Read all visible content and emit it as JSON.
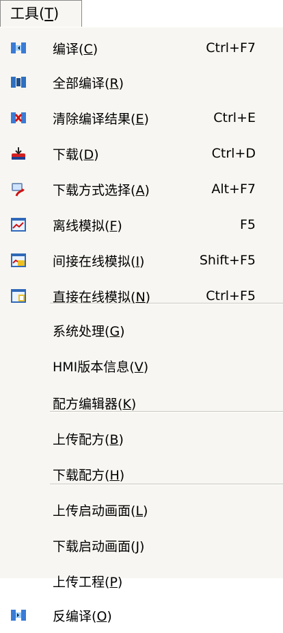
{
  "menubar": {
    "title": "工具",
    "mnemonic": "T"
  },
  "items": [
    {
      "label": "编译",
      "mn": "C",
      "shortcut": "Ctrl+F7",
      "icon": "compile-icon"
    },
    {
      "label": "全部编译",
      "mn": "R",
      "shortcut": "",
      "icon": "compile-all-icon"
    },
    {
      "label": "清除编译结果",
      "mn": "E",
      "shortcut": "Ctrl+E",
      "icon": "clear-compile-icon"
    },
    {
      "label": "下载",
      "mn": "D",
      "shortcut": "Ctrl+D",
      "icon": "download-icon"
    },
    {
      "label": "下载方式选择",
      "mn": "A",
      "shortcut": "Alt+F7",
      "icon": "download-mode-icon"
    },
    {
      "label": "离线模拟",
      "mn": "F",
      "shortcut": "F5",
      "icon": "offline-sim-icon"
    },
    {
      "label": "间接在线模拟",
      "mn": "I",
      "shortcut": "Shift+F5",
      "icon": "indirect-online-sim-icon"
    },
    {
      "label": "直接在线模拟",
      "mn": "N",
      "shortcut": "Ctrl+F5",
      "icon": "direct-online-sim-icon"
    },
    {
      "label": "系统处理",
      "mn": "G",
      "shortcut": "",
      "icon": ""
    },
    {
      "label": "HMI版本信息",
      "mn": "V",
      "shortcut": "",
      "icon": ""
    },
    {
      "label": "配方编辑器",
      "mn": "K",
      "shortcut": "",
      "icon": ""
    },
    {
      "label": "上传配方",
      "mn": "B",
      "shortcut": "",
      "icon": ""
    },
    {
      "label": "下载配方",
      "mn": "H",
      "shortcut": "",
      "icon": ""
    },
    {
      "label": "上传启动画面",
      "mn": "L",
      "shortcut": "",
      "icon": ""
    },
    {
      "label": "下载启动画面",
      "mn": "J",
      "shortcut": "",
      "icon": ""
    },
    {
      "label": "上传工程",
      "mn": "P",
      "shortcut": "",
      "icon": ""
    },
    {
      "label": "反编译",
      "mn": "O",
      "shortcut": "",
      "icon": "decompile-icon"
    }
  ]
}
